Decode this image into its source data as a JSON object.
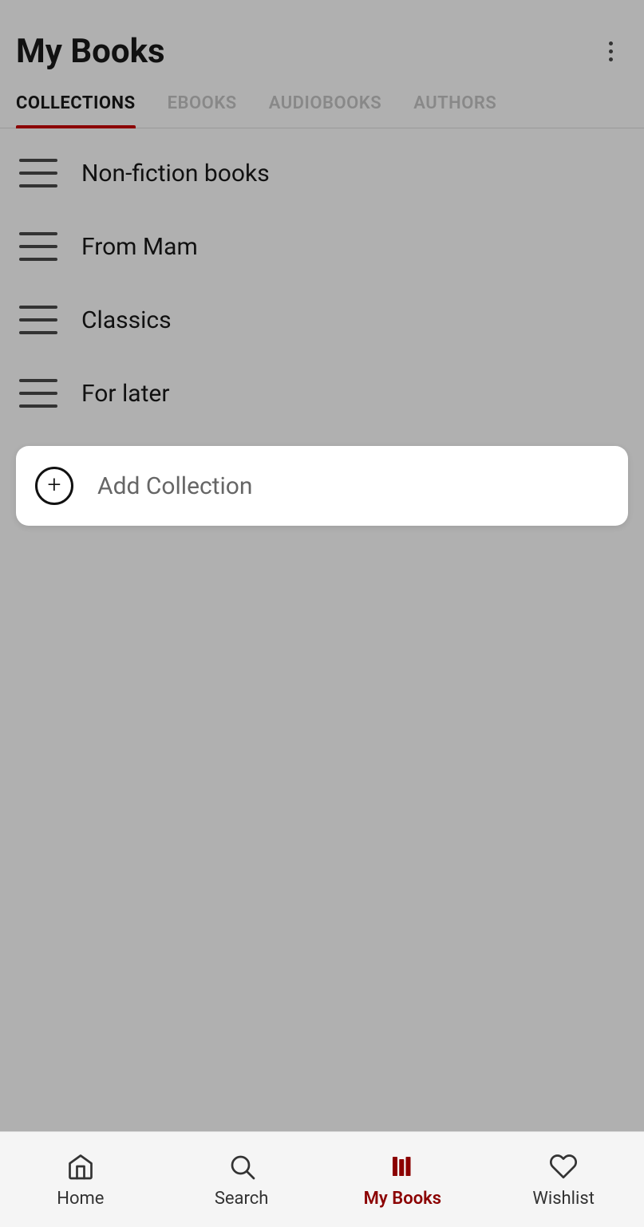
{
  "header": {
    "title": "My Books",
    "menu_label": "More options"
  },
  "tabs": [
    {
      "id": "collections",
      "label": "COLLECTIONS",
      "active": true
    },
    {
      "id": "ebooks",
      "label": "EBOOKS",
      "active": false
    },
    {
      "id": "audiobooks",
      "label": "AUDIOBOOKS",
      "active": false
    },
    {
      "id": "authors",
      "label": "AUTHORS",
      "active": false
    }
  ],
  "collections": [
    {
      "id": 1,
      "name": "Non-fiction books"
    },
    {
      "id": 2,
      "name": "From Mam"
    },
    {
      "id": 3,
      "name": "Classics"
    },
    {
      "id": 4,
      "name": "For later"
    }
  ],
  "add_collection": {
    "label": "Add Collection"
  },
  "bottom_nav": [
    {
      "id": "home",
      "label": "Home",
      "active": false
    },
    {
      "id": "search",
      "label": "Search",
      "active": false
    },
    {
      "id": "my_books",
      "label": "My Books",
      "active": true
    },
    {
      "id": "wishlist",
      "label": "Wishlist",
      "active": false
    }
  ],
  "colors": {
    "accent": "#8B0000",
    "active_nav": "#8B0000",
    "text_primary": "#111",
    "text_secondary": "#888"
  }
}
